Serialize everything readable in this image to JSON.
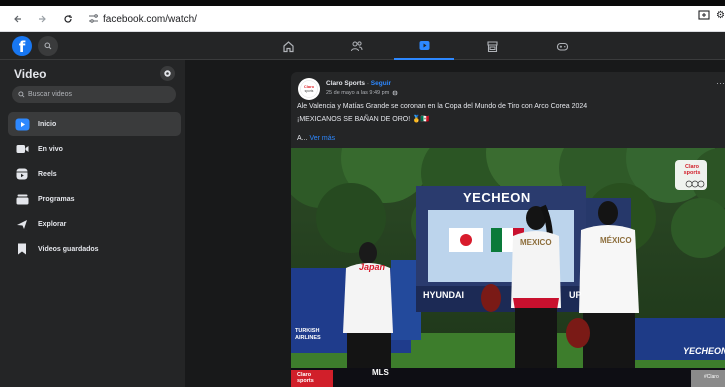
{
  "browser": {
    "url": "facebook.com/watch/",
    "back_icon": "arrow-left",
    "forward_icon": "arrow-right",
    "reload_icon": "reload",
    "site_info_icon": "tune"
  },
  "fb_header": {
    "logo_letter": "f",
    "nav_tabs": [
      "home",
      "friends",
      "watch",
      "marketplace",
      "gaming"
    ],
    "active_tab": "watch"
  },
  "sidebar": {
    "title": "Video",
    "search_placeholder": "Buscar videos",
    "items": [
      {
        "label": "Inicio",
        "icon": "watch-icon",
        "active": true
      },
      {
        "label": "En vivo",
        "icon": "live-icon",
        "active": false
      },
      {
        "label": "Reels",
        "icon": "reels-icon",
        "active": false
      },
      {
        "label": "Programas",
        "icon": "shows-icon",
        "active": false
      },
      {
        "label": "Explorar",
        "icon": "explore-icon",
        "active": false
      },
      {
        "label": "Videos guardados",
        "icon": "saved-icon",
        "active": false
      }
    ]
  },
  "post": {
    "author": "Claro Sports",
    "separator": " · ",
    "follow_label": "Seguir",
    "time": "25 de mayo a las 9:49 pm",
    "text_line1": "Ale Valencia y Matías Grande se coronan en la Copa del Mundo de Tiro con Arco Corea 2024",
    "text_line2": "¡MEXICANOS SE BAÑAN DE ORO! 🥇🇲🇽",
    "text_line3_prefix": "A... ",
    "see_more": "Ver más",
    "avatar_text": "Claro sports"
  },
  "video": {
    "scoreboard_title": "YECHEON",
    "board_right_text": "U",
    "board_bottom_text": "HYUNDAI",
    "board_bottom_suffix": "UP",
    "left_banner_text": "TURKISH AIRLINES",
    "athlete_left_shirt": "Japan",
    "athlete_mid_shirt": "MEXICO",
    "athlete_right_shirt": "MÉXICO",
    "logo_watermark": "Claro sports",
    "bottom_left_logo": "Claro sports",
    "bottom_label": "MLS",
    "right_sign": "YECHEON",
    "right_hashtag": "#Claro",
    "colors": {
      "grass": "#3c7a2c",
      "trees": "#25421c",
      "board": "#2a3b6e",
      "wall": "#1f3c8c"
    }
  }
}
